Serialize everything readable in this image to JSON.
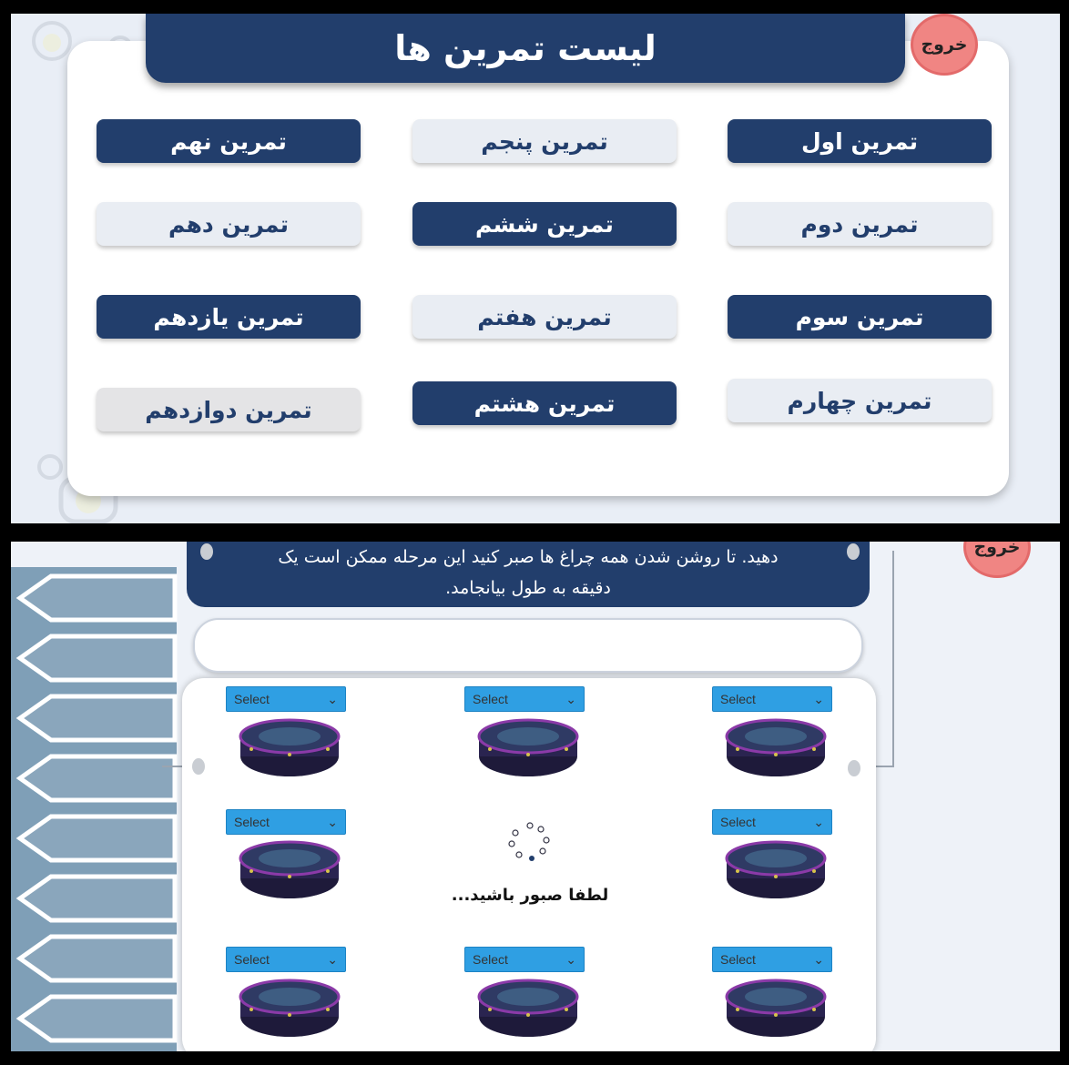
{
  "list_screen": {
    "title": "لیست تمرین ها",
    "exit_label": "خروج",
    "exercises": [
      {
        "label": "تمرین اول",
        "style": "dark"
      },
      {
        "label": "تمرین دوم",
        "style": "light"
      },
      {
        "label": "تمرین سوم",
        "style": "dark"
      },
      {
        "label": "تمرین چهارم",
        "style": "light"
      },
      {
        "label": "تمرین پنجم",
        "style": "light"
      },
      {
        "label": "تمرین ششم",
        "style": "dark"
      },
      {
        "label": "تمرین هفتم",
        "style": "light"
      },
      {
        "label": "تمرین هشتم",
        "style": "dark"
      },
      {
        "label": "تمرین نهم",
        "style": "dark"
      },
      {
        "label": "تمرین دهم",
        "style": "light"
      },
      {
        "label": "تمرین یازدهم",
        "style": "dark"
      },
      {
        "label": "تمرین دوازدهم",
        "style": "gray"
      }
    ]
  },
  "game_screen": {
    "exit_label": "خروج",
    "instruction_line1": "دهید. تا روشن شدن همه چراغ ها صبر کنید این مرحله ممکن است یک",
    "instruction_line2": "دقیقه به طول بیانجامد.",
    "select_label": "Select",
    "loading_text": "لطفا صبور باشید...",
    "colors": {
      "navy": "#223e6c",
      "select_blue": "#2f9fe3",
      "exit_pink": "#f08583"
    }
  }
}
